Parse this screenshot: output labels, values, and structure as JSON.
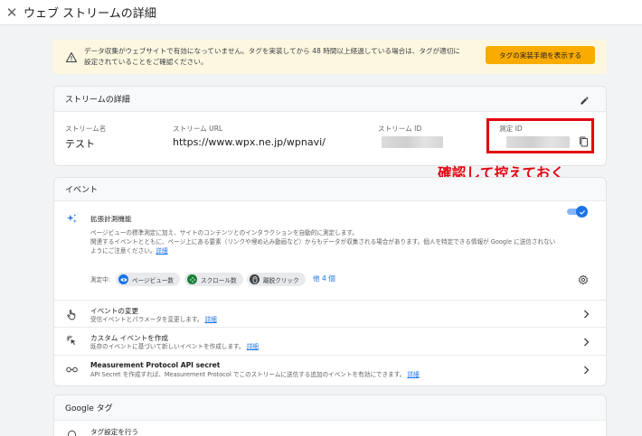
{
  "header": {
    "title": "ウェブ ストリームの詳細"
  },
  "alert": {
    "line1": "データ収集がウェブサイトで有効になっていません。タグを実装してから 48 時間以上経過している場合は、タグが適切に",
    "line2": "設定されていることをご確認ください。",
    "button": "タグの実装手順を表示する"
  },
  "stream": {
    "section_title": "ストリームの詳細",
    "name_label": "ストリーム名",
    "name_value": "テスト",
    "url_label": "ストリーム URL",
    "url_value": "https://www.wpx.ne.jp/wpnavi/",
    "id_label": "ストリーム ID",
    "mid_label": "測定 ID"
  },
  "annotation": "確認して控えておく",
  "events": {
    "section_title": "イベント",
    "enhanced_title": "拡張計測機能",
    "enhanced_desc1": "ページビューの標準測定に加え、サイトのコンテンツとのインタラクションを自動的に測定します。",
    "enhanced_desc2": "関連するイベントとともに、ページ上にある要素（リンクや埋め込み動画など）からもデータが収集される場合があります。個人を特定できる情報が Google に送信されない",
    "enhanced_desc3": "ようにご注意ください。",
    "details_link": "詳細",
    "measuring_label": "測定中:",
    "chips": [
      "ページビュー数",
      "スクロール数",
      "離脱クリック"
    ],
    "more": "他 4 個",
    "rows": [
      {
        "title": "イベントの変更",
        "sub": "受信イベントとパラメータを変更します。",
        "link": "詳細"
      },
      {
        "title": "カスタム イベントを作成",
        "sub": "既存のイベントに基づいて新しいイベントを作成します。",
        "link": "詳細"
      },
      {
        "title": "Measurement Protocol API secret",
        "sub": "API Secret を作成すれば、Measurement Protocol でこのストリームに送信する追加のイベントを有効にできます。",
        "link": "詳細"
      }
    ]
  },
  "google_tag": {
    "section_title": "Google タグ",
    "row_title": "タグ設定を行う"
  },
  "colors": {
    "accent": "#1a73e8",
    "warning": "#f9ab00",
    "highlight": "#e3000f"
  }
}
